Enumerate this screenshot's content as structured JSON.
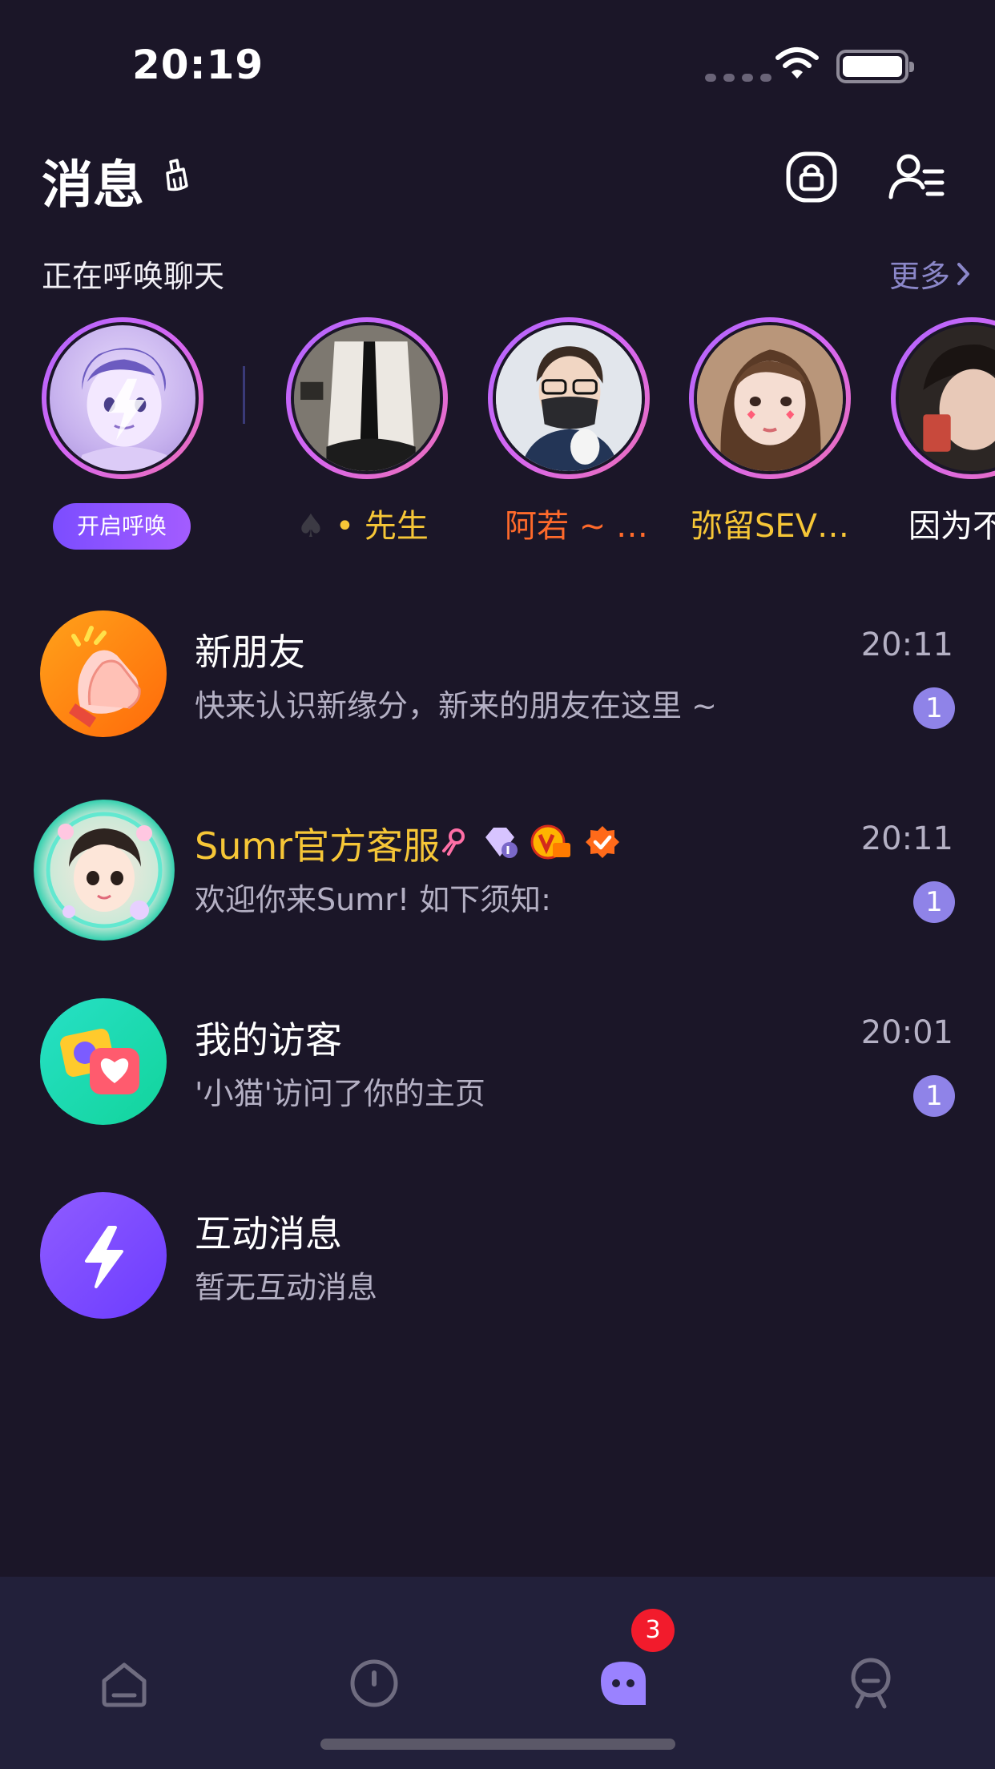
{
  "status_bar": {
    "time": "20:19"
  },
  "header": {
    "title": "消息"
  },
  "summon": {
    "section_title": "正在呼唤聊天",
    "more_label": "更多",
    "button_label": "开启呼唤",
    "users": [
      {
        "name": "• 先生",
        "name_color": "#f6c637",
        "prefix": "♠"
      },
      {
        "name": "阿若 ~ …",
        "name_color": "#ff6a2b"
      },
      {
        "name": "弥留SEV…",
        "name_color": "#f6c637"
      },
      {
        "name": "因为不",
        "name_color": "#ffffff"
      }
    ]
  },
  "messages": [
    {
      "title": "新朋友",
      "preview": "快来认识新缘分，新来的朋友在这里 ~",
      "time": "20:11",
      "badge": "1",
      "icon": "clapping-hands-icon"
    },
    {
      "title": "Sumr官方客服",
      "preview": "欢迎你来Sumr!  如下须知:",
      "time": "20:11",
      "badge": "1",
      "icon": "customer-service-avatar",
      "title_color": "#f6c637"
    },
    {
      "title": "我的访客",
      "preview": "'小猫'访问了你的主页",
      "time": "20:01",
      "badge": "1",
      "icon": "visitor-heart-icon"
    },
    {
      "title": "互动消息",
      "preview": "暂无互动消息",
      "time": "",
      "badge": "",
      "icon": "lightning-icon"
    }
  ],
  "bottom_nav": {
    "items": [
      "home-icon",
      "discover-icon",
      "messages-icon",
      "profile-icon"
    ],
    "messages_badge": "3",
    "active": "messages"
  },
  "colors": {
    "background": "#1b1628",
    "accent_purple": "#8f83e8",
    "gold": "#f6c637",
    "orange": "#ff6a2b",
    "nav_background": "#22203a"
  }
}
